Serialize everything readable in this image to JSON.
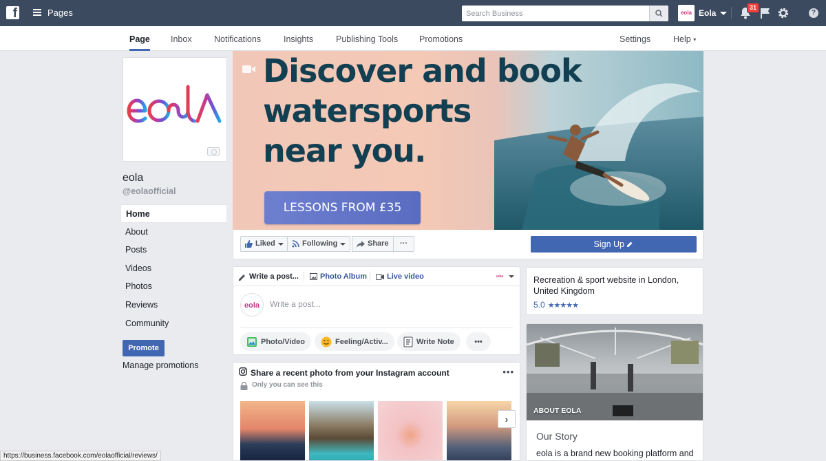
{
  "topbar": {
    "pages_label": "Pages",
    "search_placeholder": "Search Business",
    "account_name": "Eola",
    "account_thumb": "eola",
    "notification_count": "31",
    "icons": [
      "facebook-logo-icon",
      "menu-icon",
      "search-icon",
      "bell-icon",
      "flag-icon",
      "gear-icon",
      "help-icon"
    ]
  },
  "subnav": {
    "tabs": [
      {
        "label": "Page",
        "active": true
      },
      {
        "label": "Inbox"
      },
      {
        "label": "Notifications"
      },
      {
        "label": "Insights"
      },
      {
        "label": "Publishing Tools"
      },
      {
        "label": "Promotions"
      }
    ],
    "settings": "Settings",
    "help": "Help",
    "help_caret": "▾"
  },
  "profile": {
    "logo_text": "eola",
    "name": "eola",
    "handle": "@eolaofficial"
  },
  "leftnav": {
    "items": [
      {
        "label": "Home",
        "active": true
      },
      {
        "label": "About"
      },
      {
        "label": "Posts"
      },
      {
        "label": "Videos"
      },
      {
        "label": "Photos"
      },
      {
        "label": "Reviews"
      },
      {
        "label": "Community"
      }
    ],
    "promote": "Promote",
    "manage": "Manage promotions"
  },
  "cover": {
    "line1": "Discover and book",
    "line2": "watersports",
    "line3": "near you.",
    "cta": "LESSONS FROM £35"
  },
  "actions": {
    "liked": "Liked",
    "following": "Following",
    "share": "Share",
    "more": "···",
    "signup": "Sign Up"
  },
  "composer": {
    "write_tab": "Write a post...",
    "album_tab": "Photo Album",
    "live_tab": "Live video",
    "audience_thumb": "eola",
    "placeholder": "Write a post...",
    "avatar_text": "eola",
    "photo_video": "Photo/Video",
    "feeling": "Feeling/Activ...",
    "write_note": "Write Note",
    "more": "•••"
  },
  "instagram": {
    "title": "Share a recent photo from your Instagram account",
    "subtitle": "Only you can see this",
    "more": "•••",
    "next": "›"
  },
  "info": {
    "description": "Recreation & sport website in London, United Kingdom",
    "rating": "5.0",
    "stars": "★★★★★"
  },
  "about": {
    "label": "ABOUT EOLA",
    "story_title": "Our Story",
    "story_text": "eola is a brand new booking platform and"
  },
  "statusbar": "https://business.facebook.com/eolaofficial/reviews/",
  "colors": {
    "topbar": "#3b4a5e",
    "accent": "#4267b2",
    "headline": "#123f51",
    "badge": "#fa3e3e"
  }
}
